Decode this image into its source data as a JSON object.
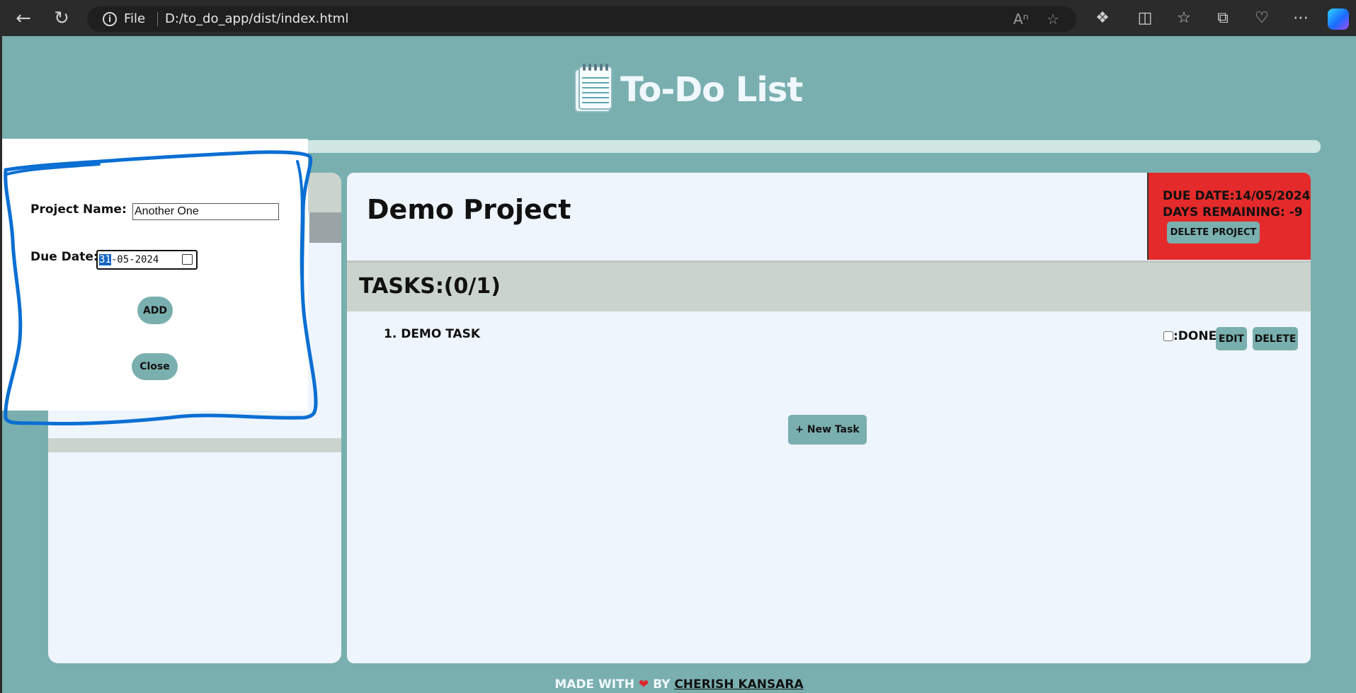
{
  "browser": {
    "scheme": "File",
    "url": "D:/to_do_app/dist/index.html"
  },
  "header": {
    "title": "To-Do List"
  },
  "project": {
    "name": "Demo Project",
    "due_date": "DUE DATE:14/05/2024",
    "days_remaining": "DAYS REMAINING: -9",
    "delete_label": "DELETE PROJECT"
  },
  "tasks": {
    "heading": "TASKS:(0/1)",
    "items": [
      {
        "label": "1. DEMO TASK",
        "done_label": ":DONE",
        "edit_label": "EDIT",
        "delete_label": "DELETE"
      }
    ],
    "new_task_label": "+ New Task"
  },
  "modal": {
    "name_label": "Project Name:",
    "name_value": "Another One",
    "date_label": "Due Date:",
    "date_day": "31",
    "date_rest": "-05-2024",
    "add_label": "ADD",
    "close_label": "Close"
  },
  "footer": {
    "made_with": "MADE WITH",
    "heart": "❤",
    "by": "BY",
    "author": "CHERISH KANSARA"
  },
  "colors": {
    "page_bg": "#7aafaf",
    "panel_bg": "#eef5fd",
    "button": "#7aafaf",
    "due_box": "#e42a2a",
    "annotation": "#0b6fd3"
  }
}
